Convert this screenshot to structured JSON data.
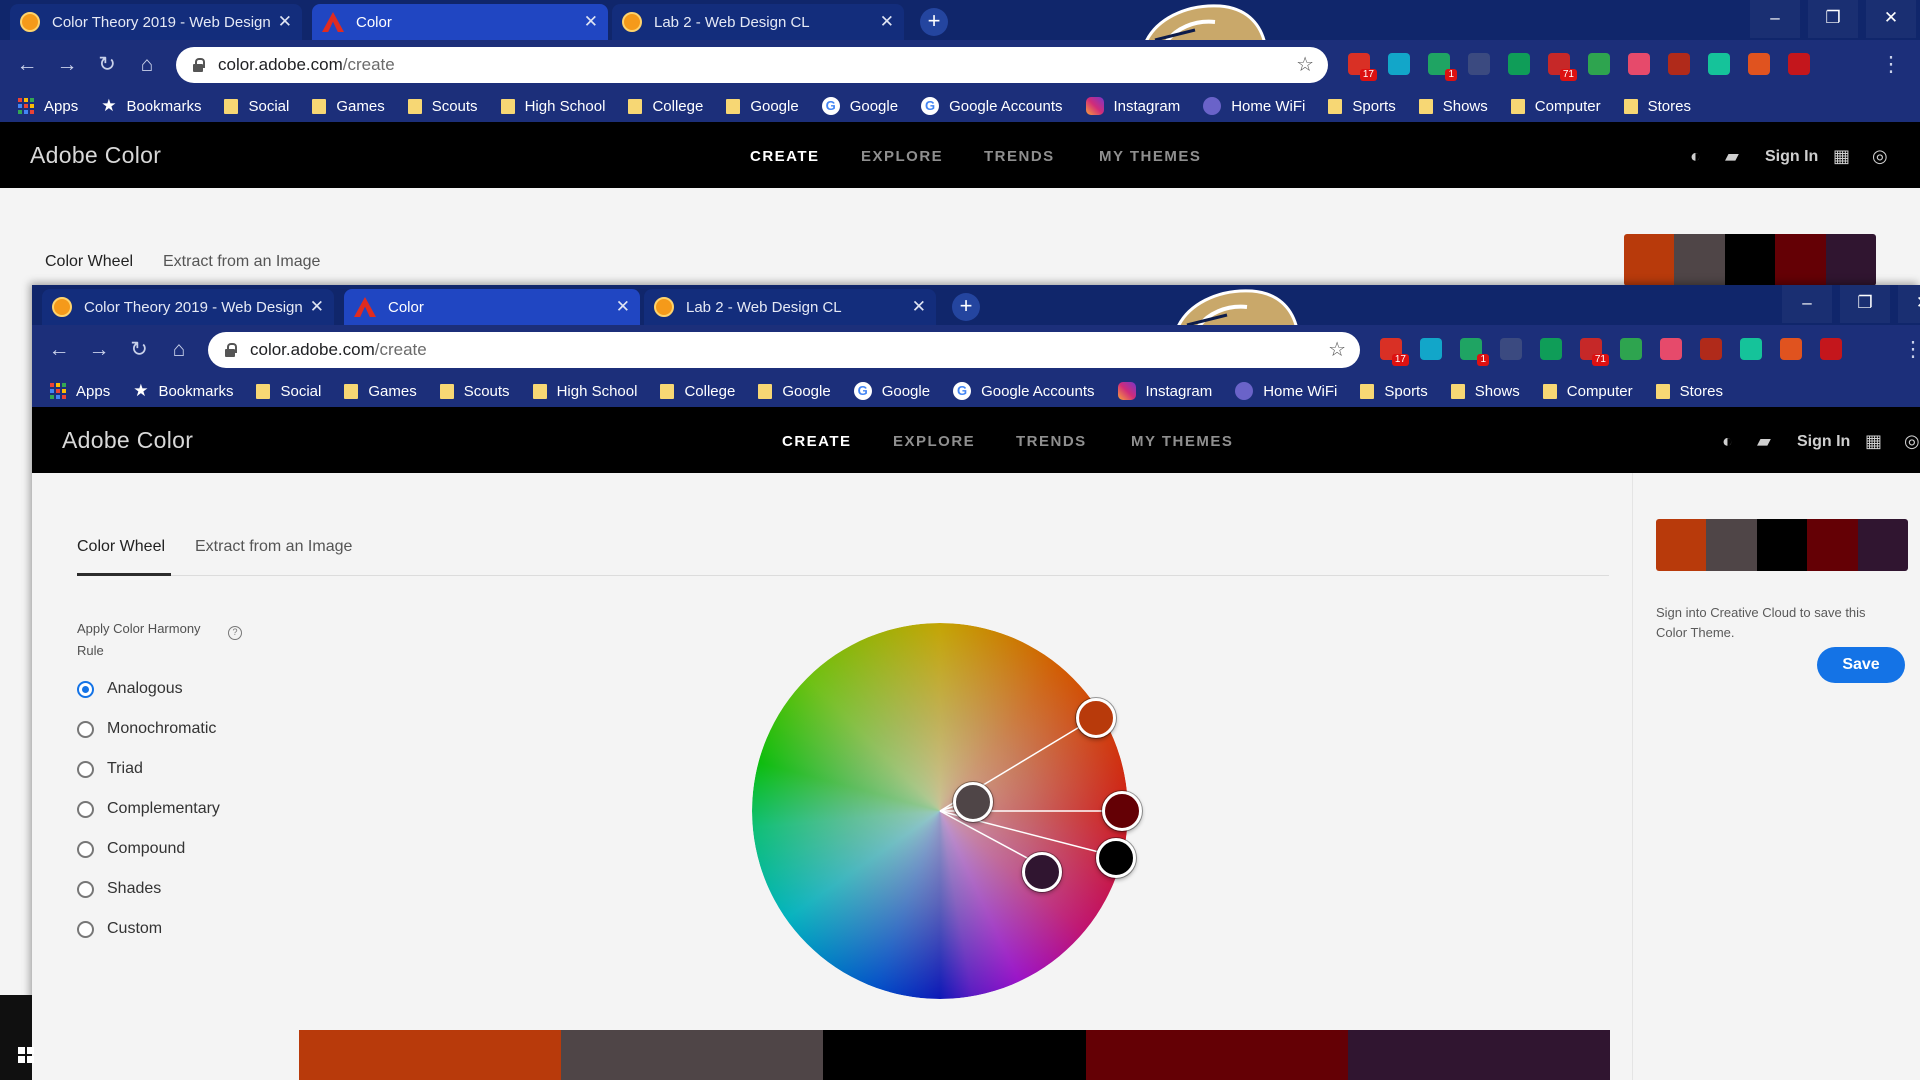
{
  "tabs": [
    {
      "label": "Color Theory 2019 - Web Design",
      "close": "✕",
      "active": false,
      "icon": "schoology-icon"
    },
    {
      "label": "Color",
      "close": "✕",
      "active": true,
      "icon": "adobe-icon"
    },
    {
      "label": "Lab 2 - Web Design CL",
      "close": "✕",
      "active": false,
      "icon": "schoology-icon"
    }
  ],
  "new_tab": "+",
  "window_controls": {
    "minimize": "–",
    "restore": "❐",
    "close": "✕"
  },
  "address": {
    "host": "color.adobe.com",
    "path": "/create"
  },
  "nav_glyphs": {
    "back": "←",
    "forward": "→",
    "reload": "↻",
    "home": "⌂",
    "star": "☆",
    "menu": "⋮"
  },
  "extensions": [
    {
      "name": "gmail-extension-icon",
      "color": "#d93025",
      "badge": "17"
    },
    {
      "name": "ip-extension-icon",
      "color": "#12a6c9",
      "badge": ""
    },
    {
      "name": "check-extension-icon",
      "color": "#1fa463",
      "badge": "1"
    },
    {
      "name": "shield-extension-icon",
      "color": "#3b4a80",
      "badge": ""
    },
    {
      "name": "hangouts-extension-icon",
      "color": "#0f9d58",
      "badge": ""
    },
    {
      "name": "unread-extension-icon",
      "color": "#c62828",
      "badge": "71"
    },
    {
      "name": "classroom-extension-icon",
      "color": "#2ea44f",
      "badge": ""
    },
    {
      "name": "arrow-extension-icon",
      "color": "#e64a6b",
      "badge": ""
    },
    {
      "name": "h-extension-icon",
      "color": "#b02a1a",
      "badge": ""
    },
    {
      "name": "grammarly-extension-icon",
      "color": "#15c39a",
      "badge": ""
    },
    {
      "name": "office-extension-icon",
      "color": "#e0531f",
      "badge": ""
    },
    {
      "name": "pdf-extension-icon",
      "color": "#c4161c",
      "badge": ""
    }
  ],
  "bookmarks": [
    {
      "label": "Apps",
      "icon": "apps"
    },
    {
      "label": "Bookmarks",
      "icon": "star"
    },
    {
      "label": "Social",
      "icon": "folder"
    },
    {
      "label": "Games",
      "icon": "folder"
    },
    {
      "label": "Scouts",
      "icon": "folder"
    },
    {
      "label": "High School",
      "icon": "folder"
    },
    {
      "label": "College",
      "icon": "folder"
    },
    {
      "label": "Google",
      "icon": "folder"
    },
    {
      "label": "Google",
      "icon": "google"
    },
    {
      "label": "Google Accounts",
      "icon": "google"
    },
    {
      "label": "Instagram",
      "icon": "instagram"
    },
    {
      "label": "Home WiFi",
      "icon": "wifi"
    },
    {
      "label": "Sports",
      "icon": "folder"
    },
    {
      "label": "Shows",
      "icon": "folder"
    },
    {
      "label": "Computer",
      "icon": "folder"
    },
    {
      "label": "Stores",
      "icon": "folder"
    }
  ],
  "app": {
    "brand": "Adobe Color",
    "nav": [
      "CREATE",
      "EXPLORE",
      "TRENDS",
      "MY THEMES"
    ],
    "active_nav": "CREATE",
    "sign_in": "Sign In"
  },
  "subtabs": {
    "wheel": "Color Wheel",
    "extract": "Extract from an Image"
  },
  "harmony": {
    "title": "Apply Color Harmony Rule",
    "help": "?",
    "options": [
      "Analogous",
      "Monochromatic",
      "Triad",
      "Complementary",
      "Compound",
      "Shades",
      "Custom"
    ],
    "selected": "Analogous"
  },
  "theme_colors": [
    "#b83a0b",
    "#4f4547",
    "#000000",
    "#640005",
    "#301530"
  ],
  "sidebar": {
    "note": "Sign into Creative Cloud to save this Color Theme.",
    "save": "Save"
  },
  "accent": "#1473e6"
}
